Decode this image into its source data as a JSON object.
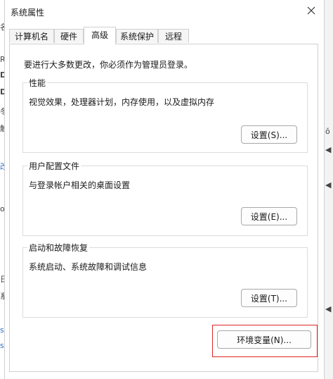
{
  "background": {
    "left_glyphs": [
      "名",
      "R",
      "D",
      "D",
      "冬",
      "触",
      "改",
      "o",
      "日",
      "系",
      "s",
      "s"
    ],
    "right_glyphs": [
      "ŏ",
      "◀",
      "◀",
      "◀"
    ]
  },
  "window": {
    "title": "系统属性"
  },
  "tabs": [
    {
      "label": "计算机名"
    },
    {
      "label": "硬件"
    },
    {
      "label": "高级"
    },
    {
      "label": "系统保护"
    },
    {
      "label": "远程"
    }
  ],
  "panel": {
    "notice": "要进行大多数更改，你必须作为管理员登录。",
    "performance": {
      "label": "性能",
      "description": "视觉效果，处理器计划，内存使用，以及虚拟内存",
      "button": "设置(S)..."
    },
    "user_profiles": {
      "label": "用户配置文件",
      "description": "与登录帐户相关的桌面设置",
      "button": "设置(E)..."
    },
    "startup_recovery": {
      "label": "启动和故障恢复",
      "description": "系统启动、系统故障和调试信息",
      "button": "设置(T)..."
    },
    "env_button": "环境变量(N)..."
  },
  "colors": {
    "highlight": "#e02424"
  }
}
